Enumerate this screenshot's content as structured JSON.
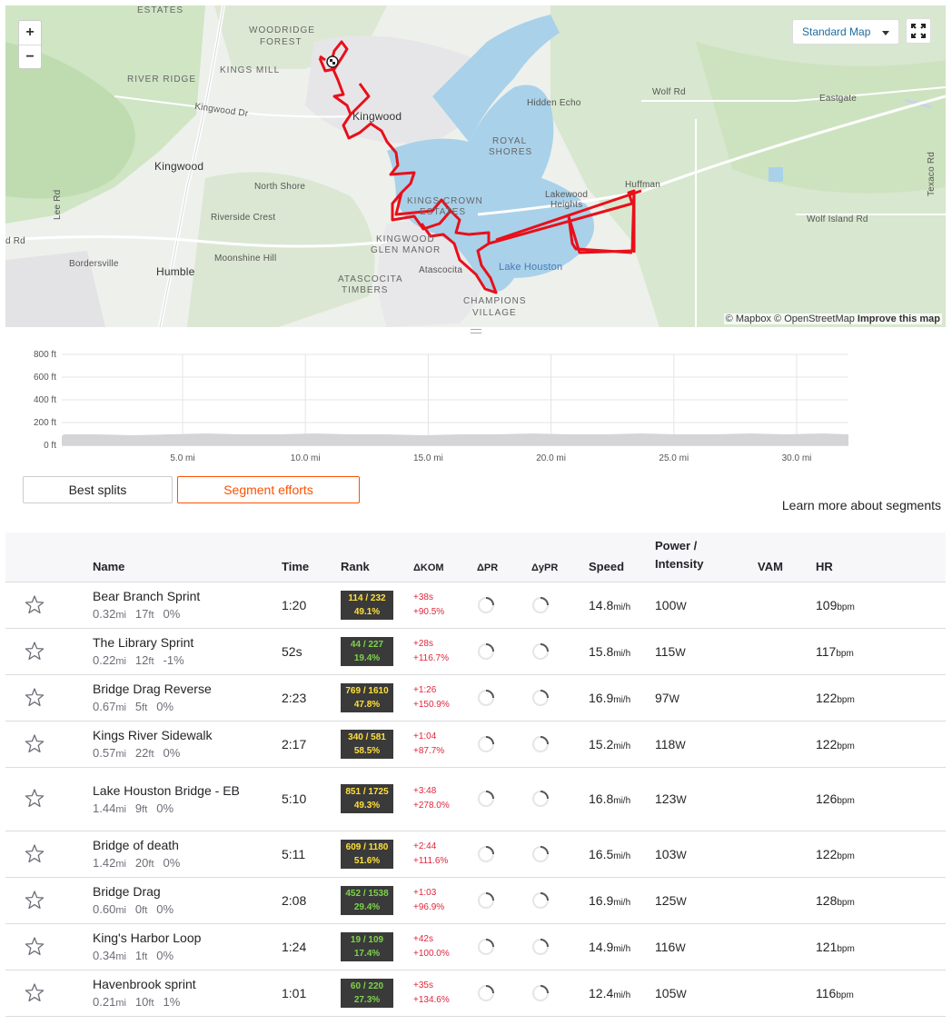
{
  "map": {
    "zoom_in": "+",
    "zoom_out": "−",
    "style_button": "Standard Map",
    "attribution_mapbox": "© Mapbox",
    "attribution_osm": "© OpenStreetMap",
    "attribution_improve": "Improve this map",
    "labels": [
      "ESTATES",
      "WOODRIDGE",
      "FOREST",
      "KINGS MILL",
      "RIVER RIDGE",
      "Kingwood Dr",
      "Kingwood",
      "Kingwood",
      "Hidden Echo",
      "Wolf Rd",
      "Eastgate",
      "ROYAL",
      "SHORES",
      "North Shore",
      "Lee Rd",
      "Riverside Crest",
      "KINGS CROWN",
      "ESTATES",
      "Lakewood",
      "Heights",
      "Huffman",
      "Texaco Rd",
      "Wolf Island Rd",
      "d Rd",
      "KINGWOOD",
      "GLEN MANOR",
      "Bordersville",
      "Humble",
      "Moonshine Hill",
      "Atascocita",
      "Lake Houston",
      "ATASCOCITA",
      "TIMBERS",
      "CHAMPIONS",
      "VILLAGE"
    ]
  },
  "elevation": {
    "y_ticks": [
      "800 ft",
      "600 ft",
      "400 ft",
      "200 ft",
      "0 ft"
    ],
    "x_ticks": [
      "5.0 mi",
      "10.0 mi",
      "15.0 mi",
      "20.0 mi",
      "25.0 mi",
      "30.0 mi"
    ]
  },
  "tabs": {
    "best_splits": "Best splits",
    "segment_efforts": "Segment efforts"
  },
  "learn_more": "Learn more about segments",
  "table": {
    "headers": {
      "name": "Name",
      "time": "Time",
      "rank": "Rank",
      "dkom": "ΔKOM",
      "dpr": "ΔPR",
      "dypr": "ΔyPR",
      "speed": "Speed",
      "power": "Power /",
      "power2": "Intensity",
      "vam": "VAM",
      "hr": "HR"
    },
    "units": {
      "mi": "mi",
      "ft": "ft",
      "speed": "mi/h",
      "power": "W",
      "hr": "bpm"
    },
    "rows": [
      {
        "name": "Bear Branch Sprint",
        "dist": "0.32",
        "elev": "17",
        "grade": "0%",
        "time": "1:20",
        "rank": "114 / 232",
        "pct": "49.1%",
        "rank_color": "yellow",
        "dkom": "+38s",
        "dkom_pct": "+90.5%",
        "speed": "14.8",
        "power": "100",
        "hr": "109"
      },
      {
        "name": "The Library Sprint",
        "dist": "0.22",
        "elev": "12",
        "grade": "-1%",
        "time": "52s",
        "rank": "44 / 227",
        "pct": "19.4%",
        "rank_color": "green",
        "dkom": "+28s",
        "dkom_pct": "+116.7%",
        "speed": "15.8",
        "power": "115",
        "hr": "117"
      },
      {
        "name": "Bridge Drag Reverse",
        "dist": "0.67",
        "elev": "5",
        "grade": "0%",
        "time": "2:23",
        "rank": "769 / 1610",
        "pct": "47.8%",
        "rank_color": "yellow",
        "dkom": "+1:26",
        "dkom_pct": "+150.9%",
        "speed": "16.9",
        "power": "97",
        "hr": "122"
      },
      {
        "name": "Kings River Sidewalk",
        "dist": "0.57",
        "elev": "22",
        "grade": "0%",
        "time": "2:17",
        "rank": "340 / 581",
        "pct": "58.5%",
        "rank_color": "yellow",
        "dkom": "+1:04",
        "dkom_pct": "+87.7%",
        "speed": "15.2",
        "power": "118",
        "hr": "122"
      },
      {
        "name": "Lake Houston Bridge - EB",
        "dist": "1.44",
        "elev": "9",
        "grade": "0%",
        "time": "5:10",
        "rank": "851 / 1725",
        "pct": "49.3%",
        "rank_color": "yellow",
        "dkom": "+3:48",
        "dkom_pct": "+278.0%",
        "speed": "16.8",
        "power": "123",
        "hr": "126"
      },
      {
        "name": "Bridge of death",
        "dist": "1.42",
        "elev": "20",
        "grade": "0%",
        "time": "5:11",
        "rank": "609 / 1180",
        "pct": "51.6%",
        "rank_color": "yellow",
        "dkom": "+2:44",
        "dkom_pct": "+111.6%",
        "speed": "16.5",
        "power": "103",
        "hr": "122"
      },
      {
        "name": "Bridge Drag",
        "dist": "0.60",
        "elev": "0",
        "grade": "0%",
        "time": "2:08",
        "rank": "452 / 1538",
        "pct": "29.4%",
        "rank_color": "green",
        "dkom": "+1:03",
        "dkom_pct": "+96.9%",
        "speed": "16.9",
        "power": "125",
        "hr": "128"
      },
      {
        "name": "King's Harbor Loop",
        "dist": "0.34",
        "elev": "1",
        "grade": "0%",
        "time": "1:24",
        "rank": "19 / 109",
        "pct": "17.4%",
        "rank_color": "green",
        "dkom": "+42s",
        "dkom_pct": "+100.0%",
        "speed": "14.9",
        "power": "116",
        "hr": "121"
      },
      {
        "name": "Havenbrook sprint",
        "dist": "0.21",
        "elev": "10",
        "grade": "1%",
        "time": "1:01",
        "rank": "60 / 220",
        "pct": "27.3%",
        "rank_color": "green",
        "dkom": "+35s",
        "dkom_pct": "+134.6%",
        "speed": "12.4",
        "power": "105",
        "hr": "116"
      }
    ]
  },
  "colors": {
    "route": "#e8101a",
    "water": "#a9d1ea",
    "accent": "#fc5200",
    "rank_yellow": "#ffe03a",
    "rank_green": "#7dd349",
    "dkom_red": "#e0263a"
  }
}
